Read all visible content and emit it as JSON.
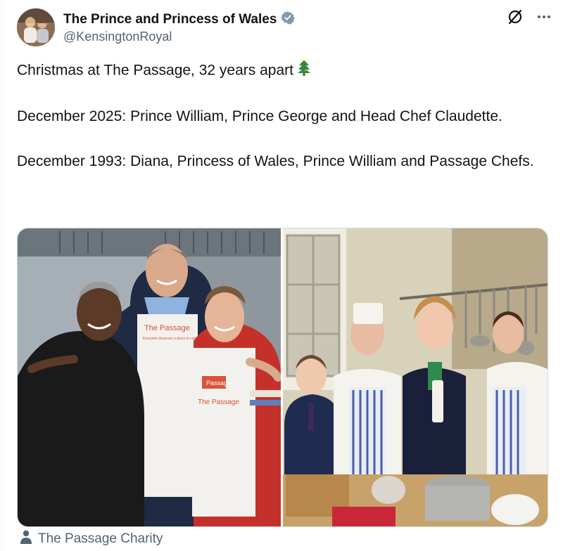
{
  "account": {
    "display_name": "The Prince and Princess of Wales",
    "handle": "@KensingtonRoyal",
    "verified_badge_color": "#829aab"
  },
  "tweet": {
    "line1": "Christmas at The Passage, 32 years apart",
    "line1_emoji": "christmas-tree",
    "line2": "December 2025: Prince William, Prince George and Head Chef Claudette.",
    "line3": "December 1993: Diana, Princess of Wales, Prince William and Passage Chefs."
  },
  "media": {
    "left_photo": {
      "apron_title": "The Passage",
      "apron_tagline": "Everyone deserves a place to call home",
      "sleeve_badge": "Passage"
    }
  },
  "attribution": {
    "text": "The Passage Charity",
    "icon": "person-icon"
  },
  "icons": {
    "grok": "grok-icon",
    "more": "more-icon"
  },
  "colors": {
    "text_primary": "#0f1419",
    "text_secondary": "#536471",
    "border": "#cfd9de",
    "apron_accent": "#d9533b"
  }
}
